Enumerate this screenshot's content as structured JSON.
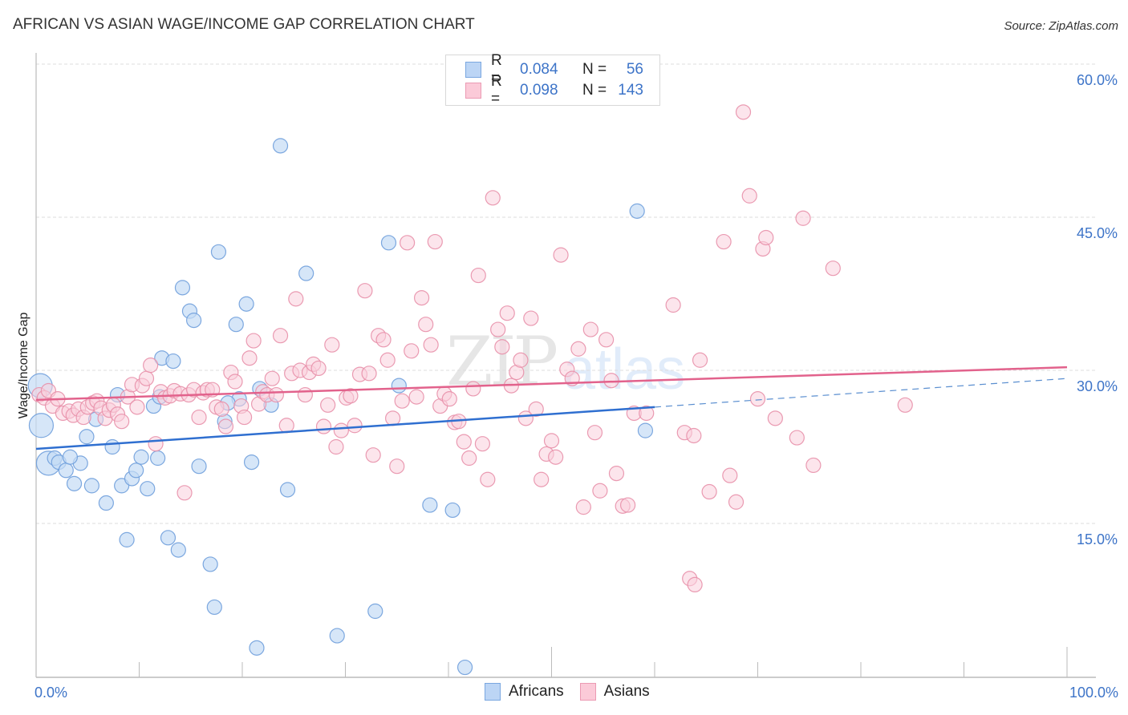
{
  "header": {
    "title": "AFRICAN VS ASIAN WAGE/INCOME GAP CORRELATION CHART",
    "source": "Source: ZipAtlas.com"
  },
  "watermark": {
    "zip": "ZIP",
    "atlas": "atlas"
  },
  "legend": {
    "rows": [
      {
        "series": "Africans",
        "r_label": "R =",
        "r_value": "0.084",
        "n_label": "N =",
        "n_value": "56",
        "color": "#a8c8f0",
        "border": "#6f9fdc"
      },
      {
        "series": "Asians",
        "r_label": "R =",
        "r_value": "0.098",
        "n_label": "N =",
        "n_value": "143",
        "color": "#f8c0d0",
        "border": "#e890aa"
      }
    ],
    "bottom": [
      "Africans",
      "Asians"
    ]
  },
  "chart_data": {
    "type": "scatter",
    "title": "AFRICAN VS ASIAN WAGE/INCOME GAP CORRELATION CHART",
    "xlabel": "",
    "ylabel": "Wage/Income Gap",
    "xlim": [
      0,
      100
    ],
    "ylim": [
      0,
      60
    ],
    "x_tick_labels": [
      "0.0%",
      "100.0%"
    ],
    "y_ticks": [
      15,
      30,
      45,
      60
    ],
    "y_tick_labels": [
      "15.0%",
      "30.0%",
      "45.0%",
      "60.0%"
    ],
    "grid": true,
    "legend_position": "top-center",
    "series": [
      {
        "name": "Africans",
        "color": "#6f9fdc",
        "fill": "#c5dbf5",
        "trendline": {
          "x": [
            0,
            60
          ],
          "y": [
            22.3,
            26.4
          ],
          "extended_dashed": {
            "x": [
              60,
              100
            ],
            "y": [
              26.4,
              29.2
            ]
          }
        },
        "points": [
          {
            "x": 0.4,
            "y": 28.5,
            "big": true
          },
          {
            "x": 0.5,
            "y": 24.6,
            "big": true
          },
          {
            "x": 1.2,
            "y": 20.9,
            "big": true
          },
          {
            "x": 1.8,
            "y": 21.4
          },
          {
            "x": 2.2,
            "y": 21.0
          },
          {
            "x": 2.9,
            "y": 20.2
          },
          {
            "x": 3.7,
            "y": 18.9
          },
          {
            "x": 4.3,
            "y": 20.9
          },
          {
            "x": 3.3,
            "y": 21.5
          },
          {
            "x": 4.9,
            "y": 23.5
          },
          {
            "x": 5.4,
            "y": 18.7
          },
          {
            "x": 5.8,
            "y": 25.2
          },
          {
            "x": 6.8,
            "y": 17.0
          },
          {
            "x": 7.4,
            "y": 22.5
          },
          {
            "x": 7.9,
            "y": 27.6
          },
          {
            "x": 8.3,
            "y": 18.7
          },
          {
            "x": 8.8,
            "y": 13.4
          },
          {
            "x": 9.3,
            "y": 19.4
          },
          {
            "x": 9.7,
            "y": 20.2
          },
          {
            "x": 10.2,
            "y": 21.5
          },
          {
            "x": 10.8,
            "y": 18.4
          },
          {
            "x": 11.4,
            "y": 26.5
          },
          {
            "x": 11.8,
            "y": 21.4
          },
          {
            "x": 12.2,
            "y": 31.2
          },
          {
            "x": 12.8,
            "y": 13.6
          },
          {
            "x": 13.3,
            "y": 30.9
          },
          {
            "x": 13.8,
            "y": 12.4
          },
          {
            "x": 14.2,
            "y": 38.1
          },
          {
            "x": 14.9,
            "y": 35.8
          },
          {
            "x": 15.3,
            "y": 34.9
          },
          {
            "x": 15.8,
            "y": 20.6
          },
          {
            "x": 16.9,
            "y": 11.0
          },
          {
            "x": 17.3,
            "y": 6.8
          },
          {
            "x": 17.7,
            "y": 41.6
          },
          {
            "x": 18.3,
            "y": 25.0
          },
          {
            "x": 19.4,
            "y": 34.5
          },
          {
            "x": 19.7,
            "y": 27.2
          },
          {
            "x": 20.4,
            "y": 36.5
          },
          {
            "x": 20.9,
            "y": 21.0
          },
          {
            "x": 21.4,
            "y": 2.8
          },
          {
            "x": 21.7,
            "y": 28.2
          },
          {
            "x": 22.8,
            "y": 26.6
          },
          {
            "x": 23.7,
            "y": 52.0
          },
          {
            "x": 24.4,
            "y": 18.3
          },
          {
            "x": 26.2,
            "y": 39.5
          },
          {
            "x": 29.2,
            "y": 4.0
          },
          {
            "x": 32.9,
            "y": 6.4
          },
          {
            "x": 34.2,
            "y": 42.5
          },
          {
            "x": 35.2,
            "y": 28.5
          },
          {
            "x": 38.2,
            "y": 16.8
          },
          {
            "x": 40.4,
            "y": 16.3
          },
          {
            "x": 41.6,
            "y": 0.9
          },
          {
            "x": 58.3,
            "y": 45.6
          },
          {
            "x": 59.1,
            "y": 24.1
          },
          {
            "x": 12.0,
            "y": 27.4
          },
          {
            "x": 18.6,
            "y": 26.8
          }
        ]
      },
      {
        "name": "Asians",
        "color": "#e890aa",
        "fill": "#fad0dc",
        "trendline": {
          "x": [
            0,
            100
          ],
          "y": [
            27.1,
            30.3
          ]
        },
        "points": [
          {
            "x": 0.3,
            "y": 27.6
          },
          {
            "x": 0.8,
            "y": 27.3
          },
          {
            "x": 1.2,
            "y": 28.0
          },
          {
            "x": 1.6,
            "y": 26.5
          },
          {
            "x": 2.1,
            "y": 27.2
          },
          {
            "x": 2.6,
            "y": 25.8
          },
          {
            "x": 3.2,
            "y": 26.0
          },
          {
            "x": 3.6,
            "y": 25.6
          },
          {
            "x": 4.1,
            "y": 26.2
          },
          {
            "x": 4.6,
            "y": 25.4
          },
          {
            "x": 5.0,
            "y": 26.4
          },
          {
            "x": 5.5,
            "y": 26.8
          },
          {
            "x": 5.9,
            "y": 27.0
          },
          {
            "x": 6.3,
            "y": 26.3
          },
          {
            "x": 6.7,
            "y": 25.3
          },
          {
            "x": 7.1,
            "y": 26.1
          },
          {
            "x": 7.5,
            "y": 26.6
          },
          {
            "x": 7.9,
            "y": 25.7
          },
          {
            "x": 8.3,
            "y": 25.0
          },
          {
            "x": 8.9,
            "y": 27.4
          },
          {
            "x": 9.3,
            "y": 28.6
          },
          {
            "x": 9.8,
            "y": 26.4
          },
          {
            "x": 10.3,
            "y": 28.5
          },
          {
            "x": 10.7,
            "y": 29.2
          },
          {
            "x": 11.1,
            "y": 30.5
          },
          {
            "x": 11.6,
            "y": 22.8
          },
          {
            "x": 12.1,
            "y": 27.9
          },
          {
            "x": 12.5,
            "y": 27.3
          },
          {
            "x": 13.0,
            "y": 27.5
          },
          {
            "x": 13.4,
            "y": 28.0
          },
          {
            "x": 14.0,
            "y": 27.7
          },
          {
            "x": 14.4,
            "y": 18.0
          },
          {
            "x": 14.8,
            "y": 27.6
          },
          {
            "x": 15.3,
            "y": 28.1
          },
          {
            "x": 15.8,
            "y": 25.4
          },
          {
            "x": 16.2,
            "y": 27.8
          },
          {
            "x": 16.6,
            "y": 28.1
          },
          {
            "x": 17.1,
            "y": 28.1
          },
          {
            "x": 17.5,
            "y": 26.4
          },
          {
            "x": 18.0,
            "y": 26.2
          },
          {
            "x": 18.4,
            "y": 24.5
          },
          {
            "x": 18.9,
            "y": 29.8
          },
          {
            "x": 19.3,
            "y": 28.9
          },
          {
            "x": 19.9,
            "y": 26.5
          },
          {
            "x": 20.2,
            "y": 25.4
          },
          {
            "x": 20.7,
            "y": 31.2
          },
          {
            "x": 21.1,
            "y": 32.9
          },
          {
            "x": 21.6,
            "y": 26.7
          },
          {
            "x": 22.0,
            "y": 27.9
          },
          {
            "x": 22.4,
            "y": 27.6
          },
          {
            "x": 22.9,
            "y": 29.2
          },
          {
            "x": 23.3,
            "y": 27.6
          },
          {
            "x": 23.7,
            "y": 33.4
          },
          {
            "x": 24.3,
            "y": 24.6
          },
          {
            "x": 24.8,
            "y": 29.7
          },
          {
            "x": 25.2,
            "y": 37.0
          },
          {
            "x": 25.6,
            "y": 30.0
          },
          {
            "x": 26.1,
            "y": 27.6
          },
          {
            "x": 26.5,
            "y": 29.8
          },
          {
            "x": 26.9,
            "y": 30.6
          },
          {
            "x": 27.4,
            "y": 30.2
          },
          {
            "x": 27.9,
            "y": 24.5
          },
          {
            "x": 28.3,
            "y": 26.6
          },
          {
            "x": 28.7,
            "y": 32.5
          },
          {
            "x": 29.1,
            "y": 22.5
          },
          {
            "x": 29.6,
            "y": 24.1
          },
          {
            "x": 30.1,
            "y": 27.3
          },
          {
            "x": 30.5,
            "y": 27.5
          },
          {
            "x": 30.9,
            "y": 24.6
          },
          {
            "x": 31.4,
            "y": 29.6
          },
          {
            "x": 31.9,
            "y": 37.8
          },
          {
            "x": 32.3,
            "y": 29.7
          },
          {
            "x": 32.7,
            "y": 21.7
          },
          {
            "x": 33.2,
            "y": 33.4
          },
          {
            "x": 33.7,
            "y": 33.0
          },
          {
            "x": 34.1,
            "y": 31.0
          },
          {
            "x": 34.6,
            "y": 25.3
          },
          {
            "x": 35.0,
            "y": 20.6
          },
          {
            "x": 35.5,
            "y": 27.0
          },
          {
            "x": 36.0,
            "y": 42.5
          },
          {
            "x": 36.4,
            "y": 31.9
          },
          {
            "x": 36.9,
            "y": 27.4
          },
          {
            "x": 37.4,
            "y": 37.1
          },
          {
            "x": 37.8,
            "y": 34.5
          },
          {
            "x": 38.3,
            "y": 32.5
          },
          {
            "x": 38.7,
            "y": 42.6
          },
          {
            "x": 39.2,
            "y": 26.5
          },
          {
            "x": 39.6,
            "y": 27.7
          },
          {
            "x": 40.1,
            "y": 27.2
          },
          {
            "x": 40.6,
            "y": 24.9
          },
          {
            "x": 41.0,
            "y": 25.0
          },
          {
            "x": 41.5,
            "y": 23.0
          },
          {
            "x": 42.0,
            "y": 21.4
          },
          {
            "x": 42.4,
            "y": 28.2
          },
          {
            "x": 42.9,
            "y": 39.3
          },
          {
            "x": 43.3,
            "y": 22.8
          },
          {
            "x": 43.8,
            "y": 19.3
          },
          {
            "x": 44.3,
            "y": 46.9
          },
          {
            "x": 44.8,
            "y": 34.0
          },
          {
            "x": 45.2,
            "y": 32.3
          },
          {
            "x": 45.7,
            "y": 35.6
          },
          {
            "x": 46.1,
            "y": 28.5
          },
          {
            "x": 46.6,
            "y": 29.8
          },
          {
            "x": 47.0,
            "y": 31.0
          },
          {
            "x": 47.5,
            "y": 25.3
          },
          {
            "x": 48.0,
            "y": 35.1
          },
          {
            "x": 48.5,
            "y": 26.2
          },
          {
            "x": 49.0,
            "y": 19.3
          },
          {
            "x": 49.5,
            "y": 21.8
          },
          {
            "x": 50.0,
            "y": 23.1
          },
          {
            "x": 50.4,
            "y": 21.5
          },
          {
            "x": 50.9,
            "y": 41.3
          },
          {
            "x": 51.5,
            "y": 30.1
          },
          {
            "x": 52.0,
            "y": 29.2
          },
          {
            "x": 52.6,
            "y": 32.1
          },
          {
            "x": 53.1,
            "y": 16.6
          },
          {
            "x": 53.8,
            "y": 34.0
          },
          {
            "x": 54.2,
            "y": 23.9
          },
          {
            "x": 54.7,
            "y": 18.2
          },
          {
            "x": 55.3,
            "y": 33.0
          },
          {
            "x": 55.8,
            "y": 29.0
          },
          {
            "x": 56.3,
            "y": 19.9
          },
          {
            "x": 56.9,
            "y": 16.7
          },
          {
            "x": 57.4,
            "y": 16.8
          },
          {
            "x": 58.0,
            "y": 25.8
          },
          {
            "x": 59.2,
            "y": 25.8
          },
          {
            "x": 61.8,
            "y": 36.4
          },
          {
            "x": 62.9,
            "y": 23.9
          },
          {
            "x": 63.8,
            "y": 23.6
          },
          {
            "x": 64.4,
            "y": 31.0
          },
          {
            "x": 63.4,
            "y": 9.6
          },
          {
            "x": 63.9,
            "y": 9.0
          },
          {
            "x": 65.3,
            "y": 18.1
          },
          {
            "x": 66.7,
            "y": 42.6
          },
          {
            "x": 67.3,
            "y": 19.7
          },
          {
            "x": 67.9,
            "y": 17.1
          },
          {
            "x": 68.6,
            "y": 55.3
          },
          {
            "x": 69.2,
            "y": 47.1
          },
          {
            "x": 70.0,
            "y": 27.2
          },
          {
            "x": 70.5,
            "y": 41.9
          },
          {
            "x": 70.8,
            "y": 43.0
          },
          {
            "x": 71.7,
            "y": 25.3
          },
          {
            "x": 73.8,
            "y": 23.4
          },
          {
            "x": 74.4,
            "y": 44.9
          },
          {
            "x": 75.4,
            "y": 20.7
          },
          {
            "x": 77.3,
            "y": 40.0
          },
          {
            "x": 84.3,
            "y": 26.6
          }
        ]
      }
    ]
  }
}
